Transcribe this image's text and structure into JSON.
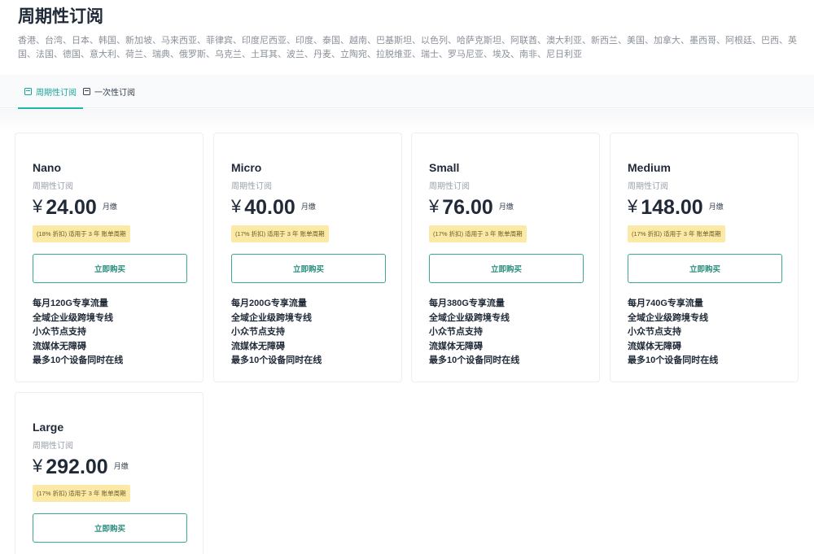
{
  "page": {
    "title": "周期性订阅",
    "regions": "香港、台湾、日本、韩国、新加坡、马来西亚、菲律宾、印度尼西亚、印度、泰国、越南、巴基斯坦、以色列、哈萨克斯坦、阿联酋、澳大利亚、新西兰、美国、加拿大、墨西哥、阿根廷、巴西、英国、法国、德国、意大利、荷兰、瑞典、俄罗斯、乌克兰、土耳其、波兰、丹麦、立陶宛、拉脱维亚、瑞士、罗马尼亚、埃及、南非、尼日利亚"
  },
  "tabs": [
    {
      "label": "周期性订阅",
      "icon": "calendar-icon",
      "active": true
    },
    {
      "label": "一次性订阅",
      "icon": "calendar-icon",
      "active": false
    }
  ],
  "accent_color": "#23b7a8",
  "badge_color": "#fde9a6",
  "plans": [
    {
      "name": "Nano",
      "period": "周期性订阅",
      "currency": "¥",
      "price": "24.00",
      "unit": "月缴",
      "discount": "(18% 折扣) 适用于 3 年 账单周期",
      "buy_label": "立即购买",
      "features": [
        "每月120G专享流量",
        "全域企业级跨境专线",
        "小众节点支持",
        "流媒体无障碍",
        "最多10个设备同时在线"
      ]
    },
    {
      "name": "Micro",
      "period": "周期性订阅",
      "currency": "¥",
      "price": "40.00",
      "unit": "月缴",
      "discount": "(17% 折扣) 适用于 3 年 账单周期",
      "buy_label": "立即购买",
      "features": [
        "每月200G专享流量",
        "全域企业级跨境专线",
        "小众节点支持",
        "流媒体无障碍",
        "最多10个设备同时在线"
      ]
    },
    {
      "name": "Small",
      "period": "周期性订阅",
      "currency": "¥",
      "price": "76.00",
      "unit": "月缴",
      "discount": "(17% 折扣) 适用于 3 年 账单周期",
      "buy_label": "立即购买",
      "features": [
        "每月380G专享流量",
        "全域企业级跨境专线",
        "小众节点支持",
        "流媒体无障碍",
        "最多10个设备同时在线"
      ]
    },
    {
      "name": "Medium",
      "period": "周期性订阅",
      "currency": "¥",
      "price": "148.00",
      "unit": "月缴",
      "discount": "(17% 折扣) 适用于 3 年 账单周期",
      "buy_label": "立即购买",
      "features": [
        "每月740G专享流量",
        "全域企业级跨境专线",
        "小众节点支持",
        "流媒体无障碍",
        "最多10个设备同时在线"
      ]
    },
    {
      "name": "Large",
      "period": "周期性订阅",
      "currency": "¥",
      "price": "292.00",
      "unit": "月缴",
      "discount": "(17% 折扣) 适用于 3 年 账单周期",
      "buy_label": "立即购买",
      "features": []
    }
  ]
}
